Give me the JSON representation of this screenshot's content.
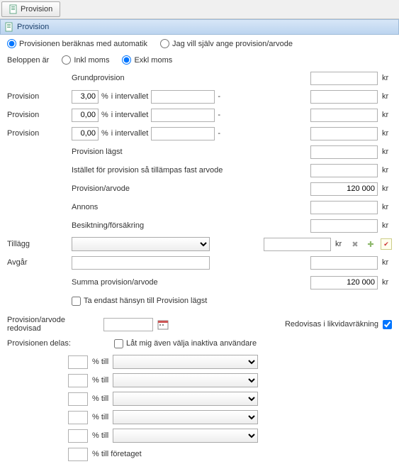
{
  "tab": {
    "label": "Provision"
  },
  "section": {
    "title": "Provision"
  },
  "calc": {
    "auto_label": "Provisionen beräknas med automatik",
    "manual_label": "Jag vill själv ange provision/arvode",
    "mode": "auto"
  },
  "amounts": {
    "prefix": "Beloppen är",
    "incl_label": "Inkl moms",
    "excl_label": "Exkl moms",
    "mode": "excl"
  },
  "labels": {
    "grundprovision": "Grundprovision",
    "provision": "Provision",
    "pct": "%",
    "i_intervallet": "i intervallet",
    "dash": "-",
    "provision_lagst": "Provision lägst",
    "fast_arvode": "Istället för provision så tillämpas fast arvode",
    "provision_arvode": "Provision/arvode",
    "annons": "Annons",
    "besiktning": "Besiktning/försäkring",
    "tillagg": "Tillägg",
    "avgar": "Avgår",
    "summa": "Summa provision/arvode",
    "endast_lagst": "Ta endast hänsyn till Provision lägst",
    "kr": "kr",
    "redovisad": "Provision/arvode redovisad",
    "redovisas_likvid": "Redovisas i likvidavräkning",
    "delas": "Provisionen delas:",
    "inaktiva": "Låt mig även välja inaktiva användare",
    "pct_till": "% till",
    "pct_till_foretaget": "% till företaget"
  },
  "tiers": [
    {
      "pct": "3,00",
      "from": "",
      "to": "",
      "amt": ""
    },
    {
      "pct": "0,00",
      "from": "",
      "to": "",
      "amt": ""
    },
    {
      "pct": "0,00",
      "from": "",
      "to": "",
      "amt": ""
    }
  ],
  "values": {
    "grundprovision": "",
    "provision_lagst": "",
    "fast_arvode": "",
    "provision_arvode": "120 000",
    "annons": "",
    "besiktning": "",
    "tillagg_amt": "",
    "avgar_text": "",
    "avgar_amt": "",
    "summa": "120 000",
    "redovisad_date": "",
    "redovisas_likvid_checked": true,
    "inaktiva_checked": false,
    "endast_lagst_checked": false
  },
  "shares": [
    {
      "pct": "",
      "user": ""
    },
    {
      "pct": "",
      "user": ""
    },
    {
      "pct": "",
      "user": ""
    },
    {
      "pct": "",
      "user": ""
    },
    {
      "pct": "",
      "user": ""
    }
  ],
  "foretaget_pct": ""
}
